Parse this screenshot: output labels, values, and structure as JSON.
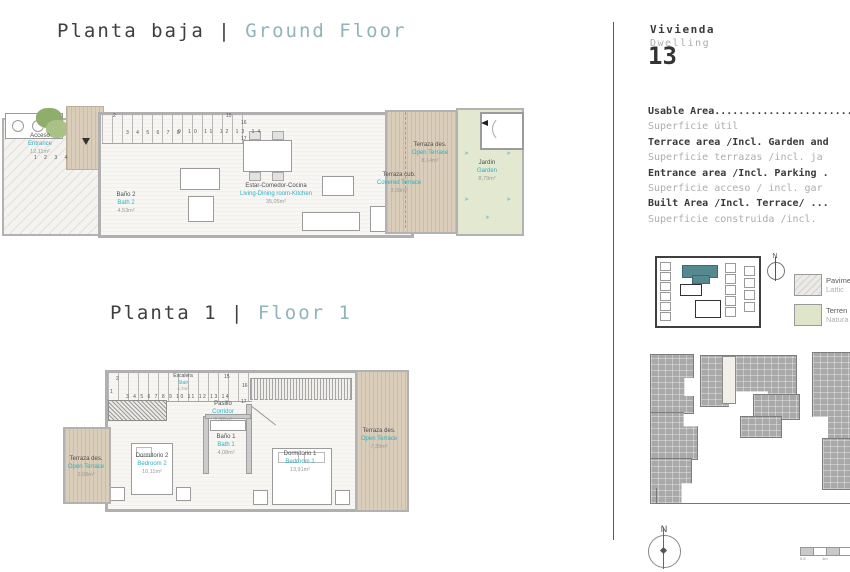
{
  "titles": {
    "ground": {
      "es": "Planta baja",
      "sep": "|",
      "en": "Ground Floor"
    },
    "floor1": {
      "es": "Planta 1",
      "sep": "|",
      "en": "Floor 1"
    }
  },
  "sidebar": {
    "dwelling_label_es": "Vivienda",
    "dwelling_label_en": "Dwelling",
    "dwelling_number": "13",
    "area_lines": [
      {
        "en": "Usable Area..........................",
        "es": "Superficie útil"
      },
      {
        "en": "Terrace area /Incl. Garden and",
        "es": "Superficie terrazas /incl. ja"
      },
      {
        "en": "Entrance area /Incl. Parking .",
        "es": "Superficie acceso / incl. gar"
      },
      {
        "en": "Built Area /Incl. Terrace/ ...",
        "es": "Superficie construida /incl. "
      }
    ],
    "legend": [
      {
        "line1": "Pavime",
        "line2": "Lattic"
      },
      {
        "line1": "Terren",
        "line2": "Natura"
      }
    ],
    "north_label": "N",
    "scale_ticks": [
      "0.5",
      "1m"
    ]
  },
  "ground_floor": {
    "rooms": [
      {
        "es": "Acceso",
        "en": "Entrance",
        "area": "12,11m²"
      },
      {
        "es": "Baño 2",
        "en": "Bath 2",
        "area": "4,53m²"
      },
      {
        "es": "Estar-Comedor-Cocina",
        "en": "Living-Dining room-Kitchen",
        "area": "35,05m²"
      },
      {
        "es": "Terraza des.",
        "en": "Open Terrace",
        "area": "8,14m²"
      },
      {
        "es": "Terraza cub.",
        "en": "Covered Terrace",
        "area": "3,08m²"
      },
      {
        "es": "Jardín",
        "en": "Garden",
        "area": "8,79m²"
      }
    ],
    "stairs": {
      "entry": "1 2 3 4",
      "run1": "3 4 5 6 7 8",
      "run2": "9 10 11 12 13 14",
      "n2": "2",
      "n15": "15",
      "n16": "16",
      "n17": "17"
    }
  },
  "floor1": {
    "rooms": [
      {
        "es": "Escalera",
        "en": "Stair",
        "area": "4,7m²"
      },
      {
        "es": "Pasillo",
        "en": "Corridor",
        "area": "1,92m²"
      },
      {
        "es": "Baño 1",
        "en": "Bath 1",
        "area": "4,08m²"
      },
      {
        "es": "Dormitorio 2",
        "en": "Bedroom 2",
        "area": "10,11m²"
      },
      {
        "es": "Dormitorio 1",
        "en": "Bedroom 1",
        "area": "13,91m²"
      },
      {
        "es": "Terraza des.",
        "en": "Open Terrace",
        "area": "3,08m²"
      },
      {
        "es": "Terraza des.",
        "en": "Open Terrace",
        "area": "7,39m²"
      }
    ],
    "stairs": {
      "n1": "1",
      "n2": "2",
      "run": "3 4 5 6 7 8 9 10 11 12 13 14",
      "n15": "15",
      "n16": "16",
      "n17": "17"
    }
  },
  "colors": {
    "accent_teal": "#2fafc2",
    "title_teal": "#8fb5ba",
    "terrace_beige": "#dacdb9",
    "garden_green": "#e3e8d1",
    "wall_gray": "#b2b2b2",
    "site_gray": "#a9a9a9"
  }
}
